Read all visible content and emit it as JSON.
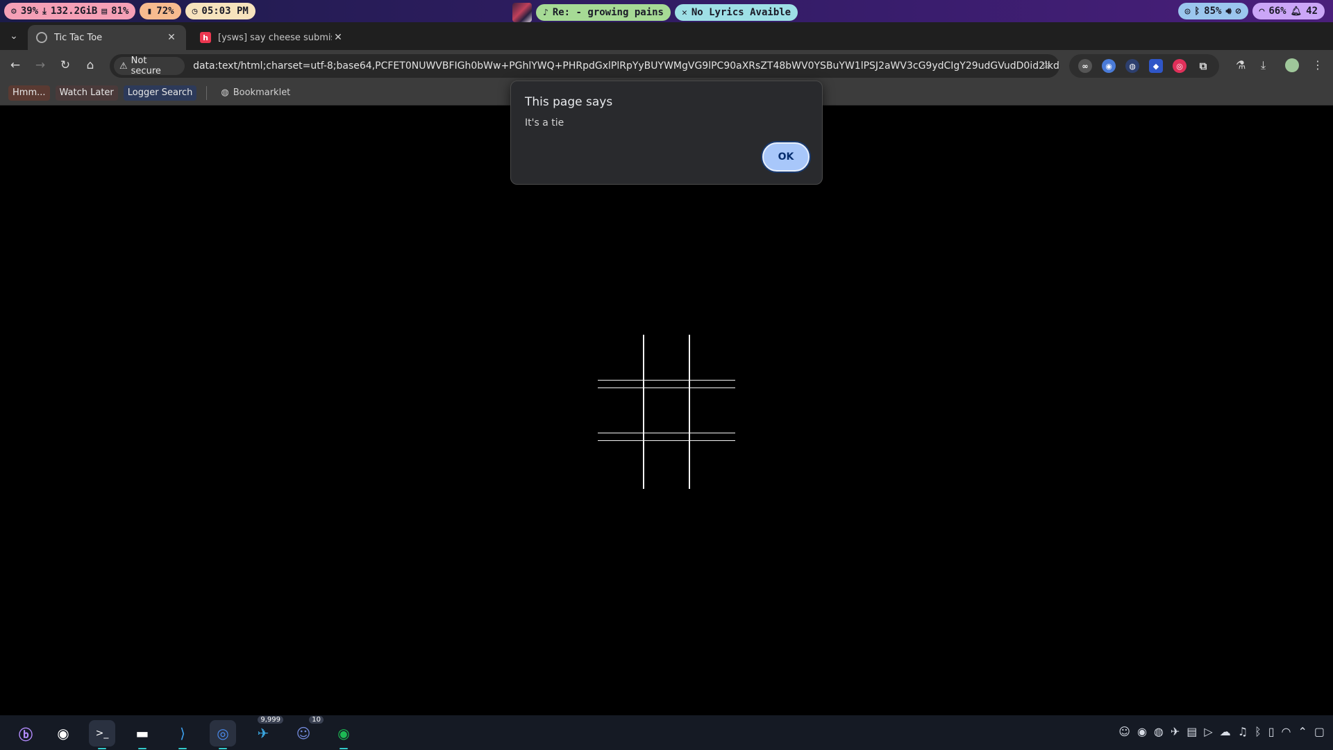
{
  "statusbar": {
    "cpu": "39%",
    "disk": "132.2GiB",
    "memory": "81%",
    "temperature": "72%",
    "clock": "05:03 PM",
    "now_playing": "Re: - growing pains",
    "lyrics": "No Lyrics Avaible",
    "bluetooth_battery": "85%",
    "battery": "66%",
    "notifications": "42"
  },
  "tabs": [
    {
      "title": "Tic Tac Toe",
      "favicon": "globe-icon"
    },
    {
      "title": "[ysws] say cheese submissi",
      "favicon": "h"
    }
  ],
  "omnibox": {
    "security_chip": "Not secure",
    "url": "data:text/html;charset=utf-8;base64,PCFET0NUWVBFIGh0bWw+PGhlYWQ+PHRpdGxlPlRpYyBUYWMgVG9lPC90aXRsZT48bWV0YSBuYW1lPSJ2aWV3cG9ydCIgY29udGVudD0id2lkdGg9Z..."
  },
  "bookmarks": [
    {
      "label": "Hmm..."
    },
    {
      "label": "Watch Later"
    },
    {
      "label": "Logger Search"
    },
    {
      "label": "Bookmarklet"
    }
  ],
  "alert": {
    "heading": "This page says",
    "message": "It's a tie",
    "ok_label": "OK"
  },
  "taskbar": {
    "telegram_badge": "9,999",
    "discord_badge": "10"
  },
  "colors": {
    "statusbar_gradient_start": "#1c1c4a",
    "statusbar_gradient_end": "#4a1f7a",
    "alert_button": "#a8c7fa",
    "page_background": "#000000"
  }
}
